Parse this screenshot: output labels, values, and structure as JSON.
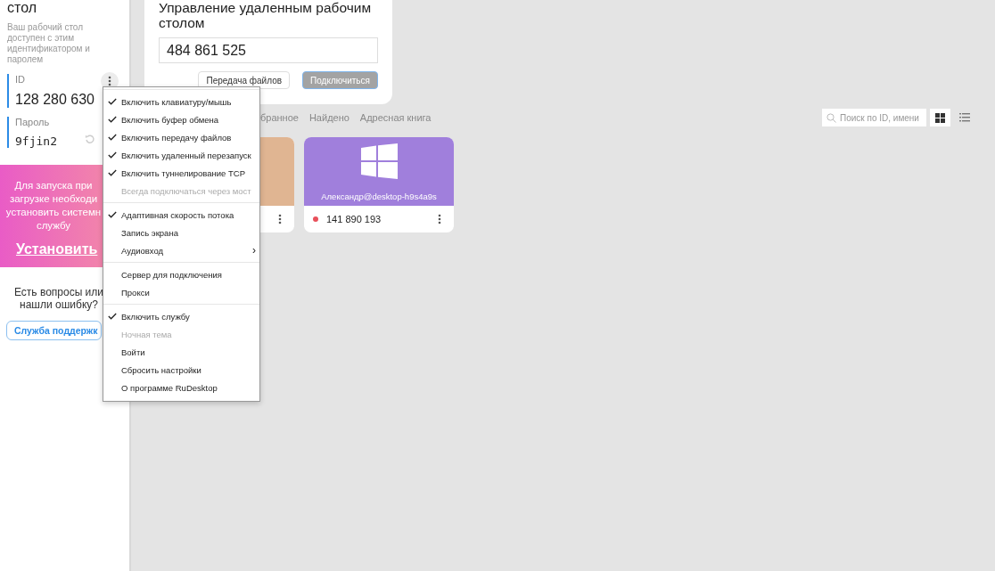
{
  "sidebar": {
    "title": "стол",
    "description": "Ваш рабочий стол доступен с этим идентификатором и паролем",
    "id_label": "ID",
    "id_value": "128 280 630",
    "password_label": "Пароль",
    "password_value": "9fjin2",
    "banner": {
      "lines": [
        "Для запуска при",
        "загрузке необходи",
        "установить системн",
        "службу"
      ],
      "install_link": "Установить"
    },
    "help": {
      "lines": [
        "Есть вопросы или",
        "нашли ошибку?"
      ],
      "support_button": "Служба поддержк"
    }
  },
  "remote": {
    "title": "Управление удаленным рабочим столом",
    "id_value": "484 861 525",
    "buttons": [
      {
        "label": "Передача файлов",
        "kind": "secondary"
      },
      {
        "label": "Подключиться",
        "kind": "primary"
      }
    ]
  },
  "tabs": [
    {
      "label": "бранное",
      "selected": false
    },
    {
      "label": "Найдено",
      "selected": false
    },
    {
      "label": "Адресная книга",
      "selected": false
    }
  ],
  "search": {
    "placeholder": "Поиск по ID, имени"
  },
  "view_buttons": [
    {
      "kind": "grid",
      "selected": true
    },
    {
      "kind": "list",
      "selected": false
    }
  ],
  "peers": [
    {
      "color": "#e0b592"
    },
    {
      "color": "#a07fdc",
      "name": "Александр@desktop-h9s4a9s",
      "id": "141 890 193",
      "status": {
        "color": "#e8505b"
      }
    }
  ],
  "menu": {
    "sections": [
      [
        {
          "label": "Включить клавиатуру/мышь",
          "checked": true,
          "disabled": false,
          "kind": "item"
        },
        {
          "label": "Включить буфер обмена",
          "checked": true,
          "disabled": false,
          "kind": "item"
        },
        {
          "label": "Включить передачу файлов",
          "checked": true,
          "disabled": false,
          "kind": "item"
        },
        {
          "label": "Включить удаленный перезапуск",
          "checked": true,
          "disabled": false,
          "kind": "item"
        },
        {
          "label": "Включить туннелирование TCP",
          "checked": true,
          "disabled": false,
          "kind": "item"
        },
        {
          "label": "Всегда подключаться через мост",
          "checked": false,
          "disabled": true,
          "kind": "item"
        }
      ],
      [
        {
          "label": "Адаптивная скорость потока",
          "checked": true,
          "disabled": false,
          "kind": "item"
        },
        {
          "label": "Запись экрана",
          "checked": false,
          "disabled": false,
          "kind": "item"
        },
        {
          "label": "Аудиовход",
          "checked": false,
          "disabled": false,
          "kind": "submenu",
          "arrow": "›"
        }
      ],
      [
        {
          "label": "Сервер для подключения",
          "checked": false,
          "disabled": false,
          "kind": "item"
        },
        {
          "label": "Прокси",
          "checked": false,
          "disabled": false,
          "kind": "item"
        }
      ],
      [
        {
          "label": "Включить службу",
          "checked": true,
          "disabled": false,
          "kind": "item"
        },
        {
          "label": "Ночная тема",
          "checked": false,
          "disabled": true,
          "kind": "item"
        },
        {
          "label": "Войти",
          "checked": false,
          "disabled": false,
          "kind": "item"
        },
        {
          "label": "Сбросить настройки",
          "checked": false,
          "disabled": false,
          "kind": "item"
        },
        {
          "label": "О программе RuDesktop",
          "checked": false,
          "disabled": false,
          "kind": "item"
        }
      ]
    ]
  }
}
